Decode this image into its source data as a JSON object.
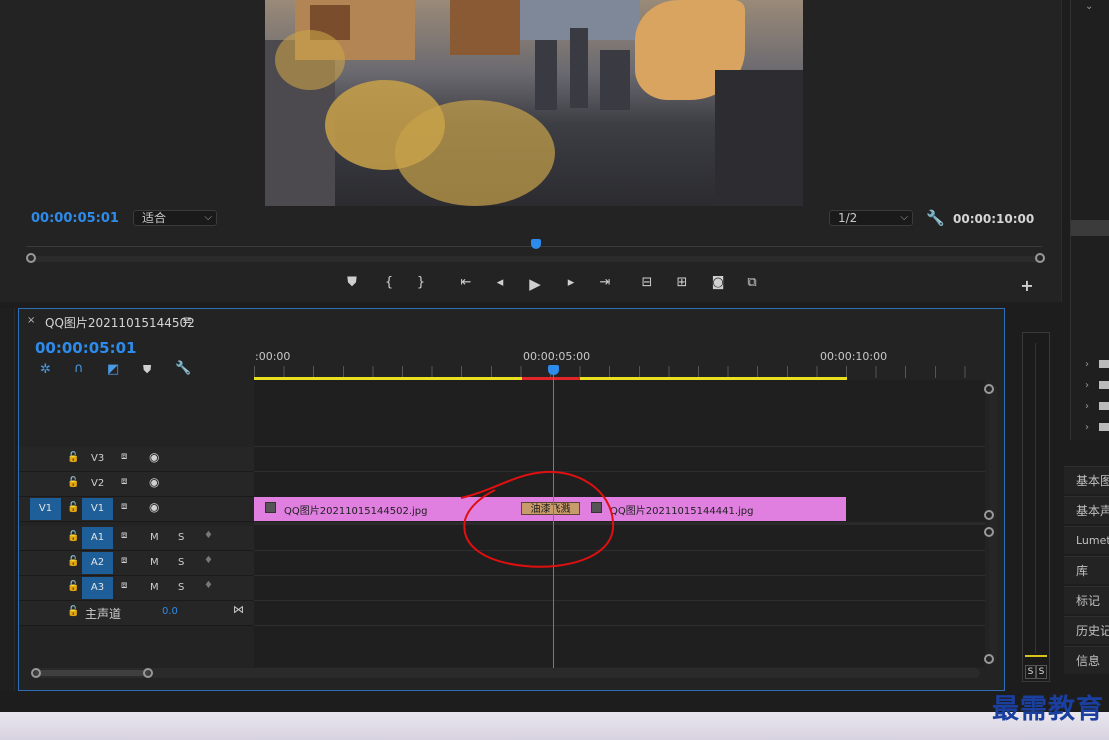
{
  "monitor": {
    "current_timecode": "00:00:05:01",
    "fit_dropdown": "适合",
    "resolution_dropdown": "1/2",
    "duration_timecode": "00:00:10:00"
  },
  "right_panels": {
    "tabs": [
      "基本图",
      "基本声",
      "Lumetr",
      "库",
      "标记",
      "历史记",
      "信息"
    ]
  },
  "timeline": {
    "sequence_name": "QQ图片20211015144502",
    "timecode": "00:00:05:01",
    "ruler_labels": [
      ":00:00",
      "00:00:05:00",
      "00:00:10:00"
    ],
    "video_tracks": [
      {
        "name": "V3",
        "target": ""
      },
      {
        "name": "V2",
        "target": ""
      },
      {
        "name": "V1",
        "target": "V1"
      }
    ],
    "audio_tracks": [
      {
        "name": "A1",
        "target": "A1",
        "mute": "M",
        "solo": "S"
      },
      {
        "name": "A2",
        "target": "A2",
        "mute": "M",
        "solo": "S"
      },
      {
        "name": "A3",
        "target": "A3",
        "mute": "M",
        "solo": "S"
      }
    ],
    "master": {
      "label": "主声道",
      "value": "0.0"
    },
    "clips": {
      "clip_a": "QQ图片20211015144502.jpg",
      "clip_b": "QQ图片20211015144441.jpg",
      "transition": "油漆飞溅"
    }
  },
  "meter": {
    "solo_a": "S",
    "solo_b": "S"
  },
  "watermark": "最需教育"
}
